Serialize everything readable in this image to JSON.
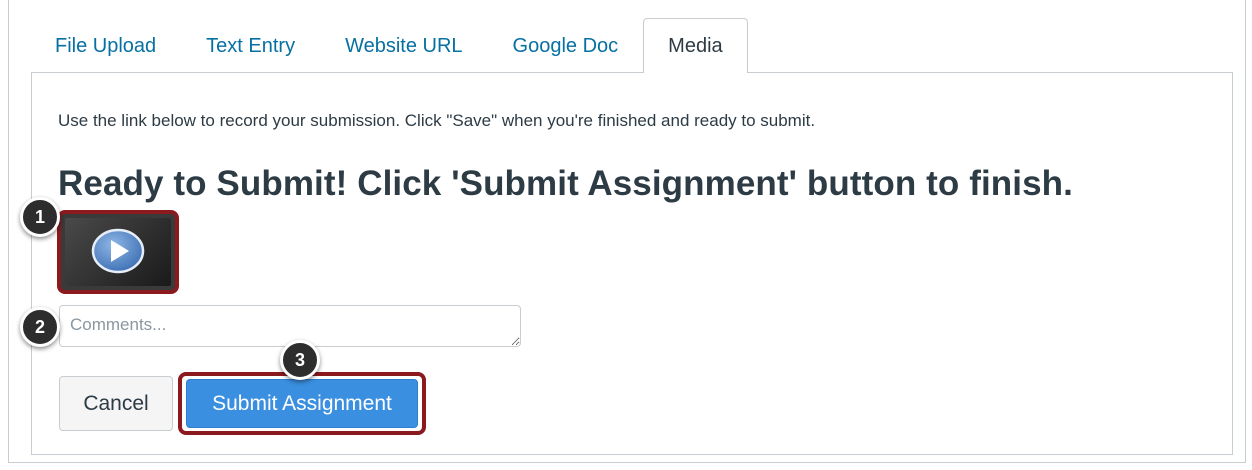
{
  "tabs": [
    {
      "label": "File Upload"
    },
    {
      "label": "Text Entry"
    },
    {
      "label": "Website URL"
    },
    {
      "label": "Google Doc"
    },
    {
      "label": "Media",
      "active": true
    }
  ],
  "panel": {
    "instruction": "Use the link below to record your submission. Click \"Save\" when you're finished and ready to submit.",
    "ready_heading": "Ready to Submit! Click 'Submit Assignment' button to finish.",
    "media_icon": "play-icon",
    "comments_placeholder": "Comments...",
    "cancel_label": "Cancel",
    "submit_label": "Submit Assignment"
  },
  "callouts": {
    "one": "1",
    "two": "2",
    "three": "3"
  },
  "colors": {
    "link": "#0770a3",
    "primary_button": "#3a8fe0",
    "highlight_border": "#8b1a1f",
    "callout_bg": "#2d2d2d"
  }
}
